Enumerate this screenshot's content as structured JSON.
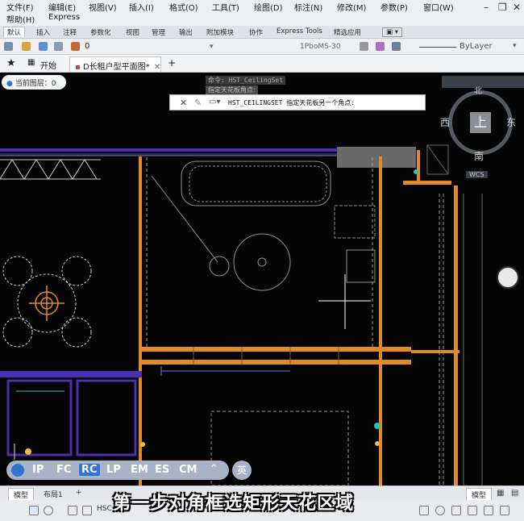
{
  "menu": {
    "items": [
      "文件(F)",
      "编辑(E)",
      "视图(V)",
      "插入(I)",
      "格式(O)",
      "工具(T)",
      "绘图(D)",
      "标注(N)",
      "修改(M)",
      "参数(P)",
      "窗口(W)",
      "帮助(H)",
      "Express"
    ]
  },
  "ribbon": {
    "tabs": [
      "默认",
      "插入",
      "注释",
      "参数化",
      "视图",
      "管理",
      "输出",
      "附加模块",
      "协作",
      "Express Tools",
      "精选应用"
    ],
    "layer_value": "0",
    "linetype_text": "1PboMS-30",
    "bylayer_text": "ByLayer"
  },
  "doc_tabs": {
    "start": "开始",
    "active": "D长租户型平面图*",
    "add": "+"
  },
  "canvas": {
    "layer_pill": "当前图层：0",
    "history_line1": "命令: HST_CeilingSet",
    "history_line2": "指定天花板角点:",
    "command_text": "HST_CEILINGSET 指定天花板另一个角点:",
    "compass": {
      "north": "北",
      "south": "南",
      "east": "东",
      "west": "西",
      "center": "上",
      "wcs": "WCS"
    }
  },
  "snap": {
    "items": [
      "IP",
      "FC",
      "RC",
      "LP",
      "EM",
      "ES",
      "CM"
    ],
    "active": "RC",
    "lang": "英"
  },
  "layout_tabs": [
    "模型",
    "布局1",
    "+"
  ],
  "status": {
    "model_label": "模型",
    "coord_text": "HSC_t"
  },
  "subtitle": "第一步对角框选矩形天花区域",
  "colors": {
    "accent": "#2f74d0",
    "plan_wall": "#e08a2a",
    "plan_purple": "#4b2fb0"
  }
}
